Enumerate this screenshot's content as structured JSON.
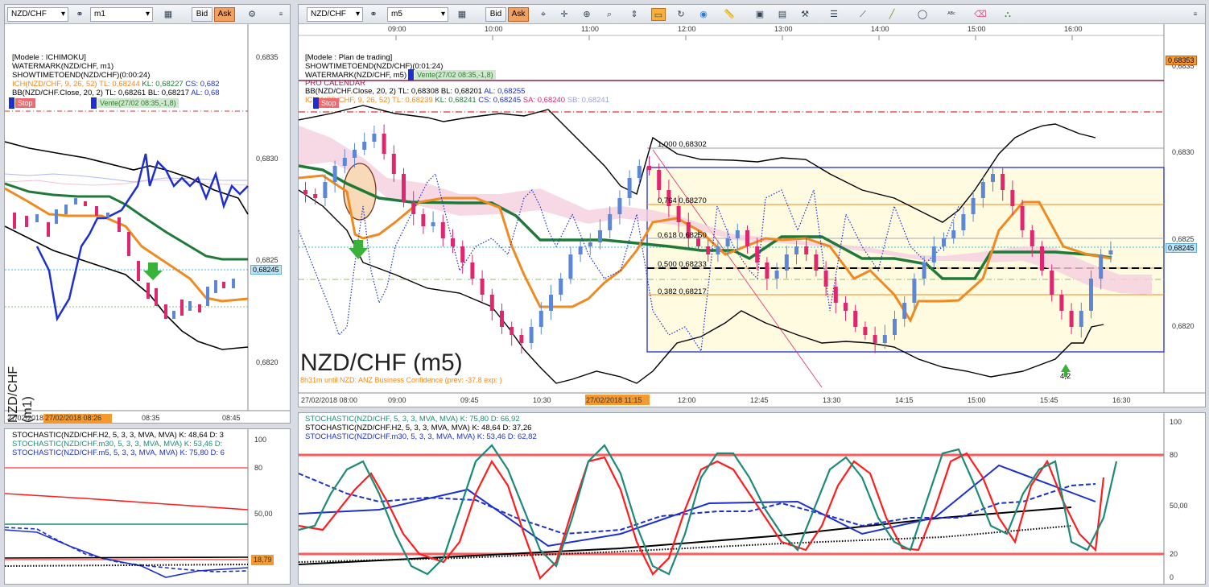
{
  "colors": {
    "up": "#5b87d6",
    "down": "#e0266f",
    "ich_orange": "#f08a20",
    "kijun_green": "#1f7a3a",
    "bb_black": "#000000",
    "stoch_red": "#ff1c1c",
    "stoch_teal": "#1d8a78",
    "stoch_blue": "#1c2fcf",
    "price_line": "#33bbee",
    "stop_red": "#e53030"
  },
  "left_chart": {
    "symbol": "NZD/CHF",
    "timeframe": "m1",
    "bid": "Bid",
    "ask": "Ask",
    "legend": [
      "[Modele : ICHIMOKU]",
      "WATERMARK(NZD/CHF, m1)",
      "SHOWTIMETOEND(NZD/CHF)(0:00:24)"
    ],
    "ich": {
      "label": "ICH(NZD/CHF, 9, 26, 52)",
      "tl": "TL: 0,68244",
      "kl": "KL: 0,68227",
      "cs": "CS: 0,682"
    },
    "bb": {
      "label": "BB(NZD/CHF.Close, 20, 2)",
      "tl": "TL: 0,68261",
      "bl": "BL: 0,68217",
      "al": "AL: 0,68"
    },
    "stop": "Stop",
    "vente": "Vente(27/02 08:35,-1,8)",
    "watermark": "NZD/CHF (m1)",
    "price_labels": [
      "0,6835",
      "0,6830",
      "0,6825",
      "0,6820"
    ],
    "current_price": "0,68245",
    "time_labels": [
      "27/02/2018",
      "27/02/2018 08:26",
      "08:35",
      "08:45"
    ]
  },
  "main_chart": {
    "symbol": "NZD/CHF",
    "timeframe": "m5",
    "bid": "Bid",
    "ask": "Ask",
    "legend": [
      "[Modele : Plan de trading]",
      "SHOWTIMETOEND(NZD/CHF)(0:01:24)",
      "WATERMARK(NZD/CHF, m5)",
      "PRO CALENDAR"
    ],
    "vente": "Vente(27/02 08:35,-1,8)",
    "bb": {
      "label": "BB(NZD/CHF.Close, 20, 2)",
      "tl": "TL: 0,68308",
      "bl": "BL: 0,68201",
      "al": "AL: 0,68255"
    },
    "ich": {
      "label": "ICH(NZD/CHF, 9, 26, 52)",
      "tl": "TL: 0,68239",
      "kl": "KL: 0,68241",
      "cs": "CS: 0,68245",
      "sa": "SA: 0,68240",
      "sb": "SB: 0,68241"
    },
    "stop": "Stop",
    "watermark": "NZD/CHF (m5)",
    "event_text": "8h31m  until NZD: ANZ Business Confidence (prev: -37.8 exp: )",
    "fib": [
      "1,000  0,68302",
      "0,764  0,68270",
      "0,618  0,68250",
      "0,500  0,68233",
      "0,382  0,68217"
    ],
    "arrow_label": "4,2",
    "price_labels": [
      "0,6835",
      "0,6830",
      "0,6825",
      "0,6820"
    ],
    "top_price": "0,68353",
    "current_price": "0,68245",
    "top_times": [
      "09:00",
      "10:00",
      "11:00",
      "12:00",
      "13:00",
      "14:00",
      "15:00",
      "16:00"
    ],
    "bottom_times": [
      "27/02/2018 08:00",
      "09:00",
      "09:45",
      "10:30",
      "27/02/2018 11:15",
      "12:00",
      "12:45",
      "13:30",
      "14:15",
      "15:00",
      "15:45",
      "16:30"
    ]
  },
  "left_stoch": {
    "lines": [
      "STOCHASTIC(NZD/CHF.H2, 5, 3, 3, MVA, MVA)  K: 48,64  D: 3",
      "STOCHASTIC(NZD/CHF.m30, 5, 3, 3, MVA, MVA)  K: 53,46   D:",
      "STOCHASTIC(NZD/CHF.m5, 5, 3, 3, MVA, MVA)  K: 75,80  D: 6"
    ],
    "levels": [
      "100",
      "80",
      "50,00",
      "18,79"
    ]
  },
  "main_stoch": {
    "lines": [
      "STOCHASTIC(NZD/CHF, 5, 3, 3, MVA, MVA)  K: 75,80  D: 66,92",
      "STOCHASTIC(NZD/CHF.H2, 5, 3, 3, MVA, MVA)  K: 48,64  D: 37,26",
      "STOCHASTIC(NZD/CHF.m30, 5, 3, 3, MVA, MVA)  K: 53,46  D: 62,82"
    ],
    "levels": [
      "100",
      "80",
      "50,00",
      "20",
      "0"
    ]
  }
}
